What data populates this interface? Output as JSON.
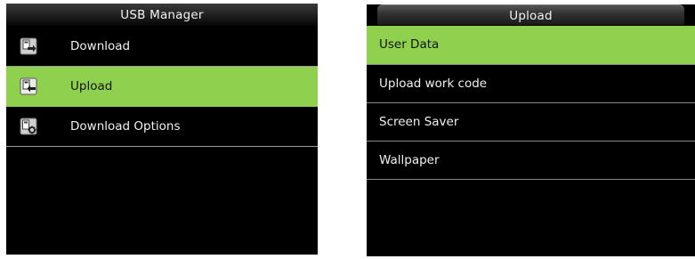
{
  "left_screen": {
    "title": "USB Manager",
    "items": [
      {
        "label": "Download",
        "icon": "usb-download-icon",
        "selected": false
      },
      {
        "label": "Upload",
        "icon": "usb-upload-icon",
        "selected": true
      },
      {
        "label": "Download Options",
        "icon": "download-options-icon",
        "selected": false
      }
    ]
  },
  "right_screen": {
    "title": "Upload",
    "items": [
      {
        "label": "User Data",
        "selected": true
      },
      {
        "label": "Upload work code",
        "selected": false
      },
      {
        "label": "Screen Saver",
        "selected": false
      },
      {
        "label": "Wallpaper",
        "selected": false
      }
    ]
  },
  "colors": {
    "selected_background": "#8fd14f",
    "screen_background": "#000000",
    "divider": "#9a9a9a"
  }
}
